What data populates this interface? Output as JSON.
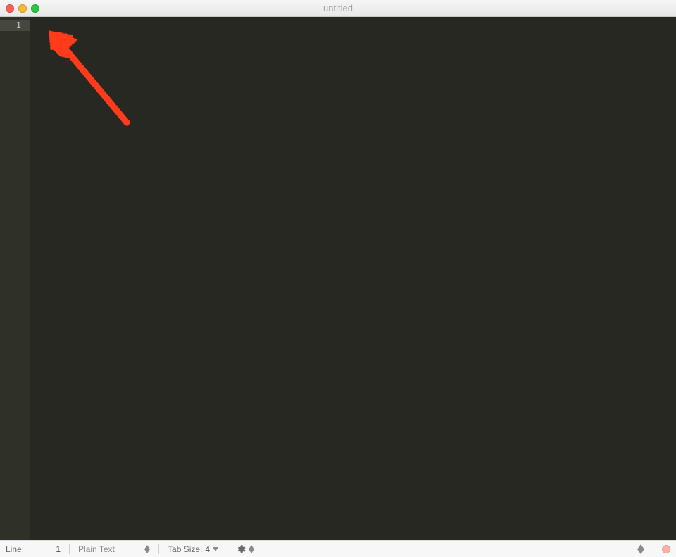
{
  "titlebar": {
    "title": "untitled"
  },
  "editor": {
    "line_numbers": [
      "1"
    ]
  },
  "statusbar": {
    "line_label": "Line:",
    "line_value": "1",
    "language": "Plain Text",
    "tab_label": "Tab Size:",
    "tab_value": "4"
  },
  "annotation": {
    "type": "arrow",
    "color": "#ff3b1f"
  }
}
